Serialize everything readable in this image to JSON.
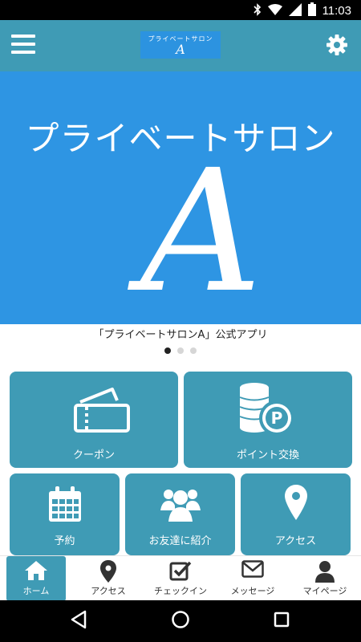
{
  "status": {
    "time": "11:03"
  },
  "header": {
    "logo_small": "プライベートサロン",
    "logo_big": "A"
  },
  "hero": {
    "title": "プライベートサロン",
    "letter": "A"
  },
  "caption": "「プライベートサロンA」公式アプリ",
  "tiles": {
    "coupon": "クーポン",
    "points": "ポイント交換",
    "reserve": "予約",
    "invite": "お友達に紹介",
    "access": "アクセス"
  },
  "nav": {
    "home": "ホーム",
    "access": "アクセス",
    "checkin": "チェックイン",
    "message": "メッセージ",
    "mypage": "マイページ"
  },
  "colors": {
    "header": "#3f9bb5",
    "hero": "#2e95e3",
    "tile": "#3f9bb5"
  }
}
